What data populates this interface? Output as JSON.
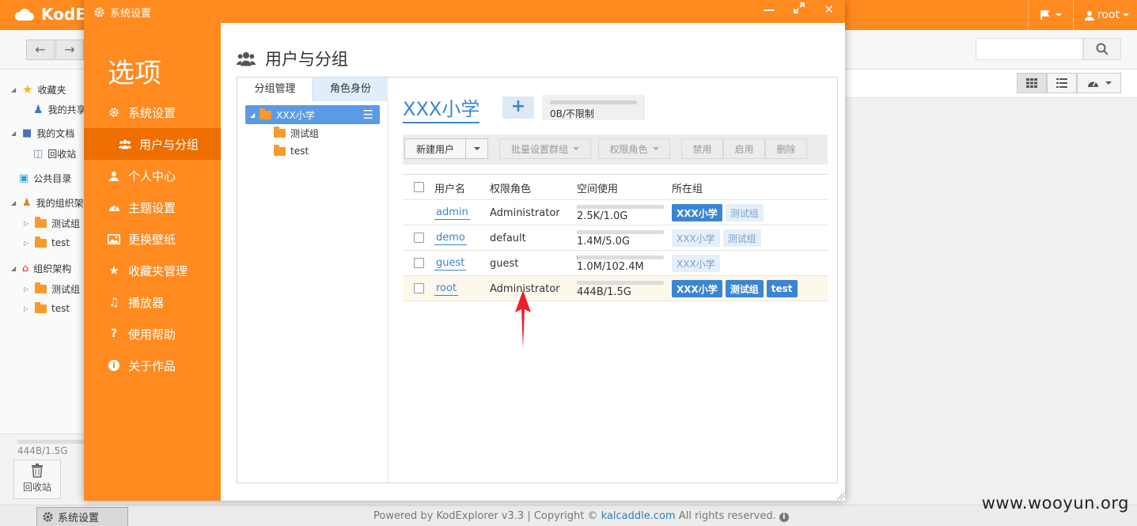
{
  "app": {
    "logo_text": "KodE",
    "user_label": "root",
    "icons": {
      "flag": "flag-icon",
      "user": "user-icon",
      "search": "search-icon",
      "cloud": "cloud-logo-icon"
    }
  },
  "sidebar": {
    "items": [
      {
        "label": "收藏夹"
      },
      {
        "label": "我的共享"
      },
      {
        "label": "我的文档"
      },
      {
        "label": "回收站"
      },
      {
        "label": "公共目录"
      },
      {
        "label": "我的组织架构"
      },
      {
        "label": "测试组"
      },
      {
        "label": "test"
      },
      {
        "label": "组织架构"
      },
      {
        "label": "测试组"
      },
      {
        "label": "test"
      }
    ],
    "space_text": "444B/1.5G",
    "recycle_label": "回收站"
  },
  "dialog": {
    "title": "系统设置",
    "side_title": "选项",
    "menu": [
      {
        "label": "系统设置"
      },
      {
        "label": "用户与分组"
      },
      {
        "label": "个人中心"
      },
      {
        "label": "主题设置"
      },
      {
        "label": "更换壁纸"
      },
      {
        "label": "收藏夹管理"
      },
      {
        "label": "播放器"
      },
      {
        "label": "使用帮助"
      },
      {
        "label": "关于作品"
      }
    ],
    "active_menu_index": 1,
    "heading": "用户与分组",
    "tabs": {
      "group_tab": "分组管理",
      "role_tab": "角色身份"
    },
    "groups": [
      {
        "label": "XXX小学"
      },
      {
        "label": "测试组"
      },
      {
        "label": "test"
      }
    ],
    "group": {
      "name": "XXX小学",
      "add_label": "+",
      "quota": "0B/不限制"
    },
    "actions": {
      "new_user": "新建用户",
      "batch_group": "批量设置群组",
      "role": "权限角色",
      "disable": "禁用",
      "enable": "启用",
      "delete": "删除"
    },
    "table": {
      "headers": {
        "username": "用户名",
        "role": "权限角色",
        "space": "空间使用",
        "groups": "所在组"
      },
      "rows": [
        {
          "name": "admin",
          "role": "Administrator",
          "space": "2.5K/1.0G",
          "used": 0.0,
          "tags": [
            {
              "label": "XXX小学",
              "on": true
            },
            {
              "label": "测试组",
              "on": false
            }
          ]
        },
        {
          "name": "demo",
          "role": "default",
          "space": "1.4M/5.0G",
          "used": 0.0,
          "tags": [
            {
              "label": "XXX小学",
              "on": false
            },
            {
              "label": "测试组",
              "on": false
            }
          ]
        },
        {
          "name": "guest",
          "role": "guest",
          "space": "1.0M/102.4M",
          "used": 0.01,
          "tags": [
            {
              "label": "XXX小学",
              "on": false
            }
          ]
        },
        {
          "name": "root",
          "role": "Administrator",
          "space": "444B/1.5G",
          "used": 0.0,
          "tags": [
            {
              "label": "XXX小学",
              "on": true
            },
            {
              "label": "测试组",
              "on": true
            },
            {
              "label": "test",
              "on": true
            }
          ]
        }
      ]
    }
  },
  "footer": {
    "taskbar_label": "系统设置",
    "powered": "Powered by KodExplorer v3.3 | Copyright ©",
    "link": "kalcaddle.com",
    "rights": "All rights reserved."
  },
  "watermark": "www.wooyun.org",
  "colors": {
    "accent": "#ff8a1f",
    "accent_dark": "#ee6f00",
    "link": "#3b86d3",
    "annotation": "#e8212b"
  }
}
